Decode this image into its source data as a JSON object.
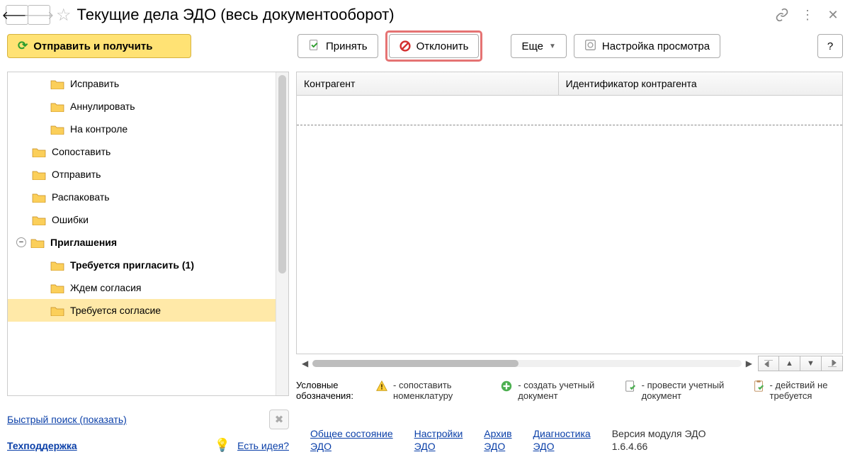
{
  "header": {
    "title": "Текущие дела ЭДО (весь документооборот)"
  },
  "toolbar": {
    "send_receive": "Отправить и получить",
    "accept": "Принять",
    "reject": "Отклонить",
    "more": "Еще",
    "view_settings": "Настройка просмотра",
    "help": "?"
  },
  "tree": [
    {
      "label": "Исправить",
      "indent": 2
    },
    {
      "label": "Аннулировать",
      "indent": 2
    },
    {
      "label": "На контроле",
      "indent": 2
    },
    {
      "label": "Сопоставить",
      "indent": 1
    },
    {
      "label": "Отправить",
      "indent": 1
    },
    {
      "label": "Распаковать",
      "indent": 1
    },
    {
      "label": "Ошибки",
      "indent": 1
    },
    {
      "label": "Приглашения",
      "indent": 1,
      "bold": true,
      "expand": true
    },
    {
      "label": "Требуется пригласить (1)",
      "indent": 2,
      "bold": true
    },
    {
      "label": "Ждем согласия",
      "indent": 2
    },
    {
      "label": "Требуется согласие",
      "indent": 2,
      "selected": true
    }
  ],
  "grid": {
    "col1": "Контрагент",
    "col2": "Идентификатор контрагента"
  },
  "legend": {
    "label": "Условные обозначения:",
    "items": [
      "- сопоставить номенклатуру",
      "- создать учетный документ",
      "- провести учетный документ",
      "- действий не требуется"
    ]
  },
  "left_links": {
    "quick_search": "Быстрый поиск (показать)",
    "support": "Техподдержка",
    "idea": "Есть идея?"
  },
  "footer_links": {
    "l1a": "Общее состояние",
    "l1b": "ЭДО",
    "l2a": "Настройки",
    "l2b": "ЭДО",
    "l3a": "Архив",
    "l3b": "ЭДО",
    "l4a": "Диагностика",
    "l4b": "ЭДО",
    "version_a": "Версия модуля ЭДО",
    "version_b": "1.6.4.66"
  }
}
